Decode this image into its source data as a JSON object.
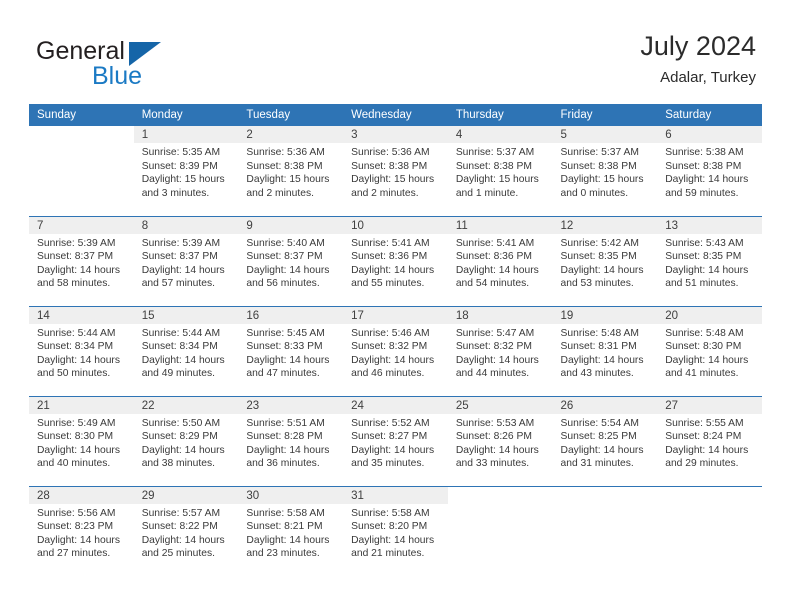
{
  "brand": {
    "word1": "General",
    "word2": "Blue",
    "flag_icon": "blue-flag-icon",
    "accent_color": "#1b7ac4"
  },
  "header": {
    "title": "July 2024",
    "subtitle": "Adalar, Turkey"
  },
  "theme": {
    "header_bg": "#2e74b5",
    "daynum_bg": "#efefef",
    "grid_line": "#2e74b5",
    "text": "#3a3a3a"
  },
  "calendar": {
    "weekday_headers": [
      "Sunday",
      "Monday",
      "Tuesday",
      "Wednesday",
      "Thursday",
      "Friday",
      "Saturday"
    ],
    "weeks": [
      [
        {
          "day": "",
          "lines": []
        },
        {
          "day": "1",
          "lines": [
            "Sunrise: 5:35 AM",
            "Sunset: 8:39 PM",
            "Daylight: 15 hours",
            "and 3 minutes."
          ]
        },
        {
          "day": "2",
          "lines": [
            "Sunrise: 5:36 AM",
            "Sunset: 8:38 PM",
            "Daylight: 15 hours",
            "and 2 minutes."
          ]
        },
        {
          "day": "3",
          "lines": [
            "Sunrise: 5:36 AM",
            "Sunset: 8:38 PM",
            "Daylight: 15 hours",
            "and 2 minutes."
          ]
        },
        {
          "day": "4",
          "lines": [
            "Sunrise: 5:37 AM",
            "Sunset: 8:38 PM",
            "Daylight: 15 hours",
            "and 1 minute."
          ]
        },
        {
          "day": "5",
          "lines": [
            "Sunrise: 5:37 AM",
            "Sunset: 8:38 PM",
            "Daylight: 15 hours",
            "and 0 minutes."
          ]
        },
        {
          "day": "6",
          "lines": [
            "Sunrise: 5:38 AM",
            "Sunset: 8:38 PM",
            "Daylight: 14 hours",
            "and 59 minutes."
          ]
        }
      ],
      [
        {
          "day": "7",
          "lines": [
            "Sunrise: 5:39 AM",
            "Sunset: 8:37 PM",
            "Daylight: 14 hours",
            "and 58 minutes."
          ]
        },
        {
          "day": "8",
          "lines": [
            "Sunrise: 5:39 AM",
            "Sunset: 8:37 PM",
            "Daylight: 14 hours",
            "and 57 minutes."
          ]
        },
        {
          "day": "9",
          "lines": [
            "Sunrise: 5:40 AM",
            "Sunset: 8:37 PM",
            "Daylight: 14 hours",
            "and 56 minutes."
          ]
        },
        {
          "day": "10",
          "lines": [
            "Sunrise: 5:41 AM",
            "Sunset: 8:36 PM",
            "Daylight: 14 hours",
            "and 55 minutes."
          ]
        },
        {
          "day": "11",
          "lines": [
            "Sunrise: 5:41 AM",
            "Sunset: 8:36 PM",
            "Daylight: 14 hours",
            "and 54 minutes."
          ]
        },
        {
          "day": "12",
          "lines": [
            "Sunrise: 5:42 AM",
            "Sunset: 8:35 PM",
            "Daylight: 14 hours",
            "and 53 minutes."
          ]
        },
        {
          "day": "13",
          "lines": [
            "Sunrise: 5:43 AM",
            "Sunset: 8:35 PM",
            "Daylight: 14 hours",
            "and 51 minutes."
          ]
        }
      ],
      [
        {
          "day": "14",
          "lines": [
            "Sunrise: 5:44 AM",
            "Sunset: 8:34 PM",
            "Daylight: 14 hours",
            "and 50 minutes."
          ]
        },
        {
          "day": "15",
          "lines": [
            "Sunrise: 5:44 AM",
            "Sunset: 8:34 PM",
            "Daylight: 14 hours",
            "and 49 minutes."
          ]
        },
        {
          "day": "16",
          "lines": [
            "Sunrise: 5:45 AM",
            "Sunset: 8:33 PM",
            "Daylight: 14 hours",
            "and 47 minutes."
          ]
        },
        {
          "day": "17",
          "lines": [
            "Sunrise: 5:46 AM",
            "Sunset: 8:32 PM",
            "Daylight: 14 hours",
            "and 46 minutes."
          ]
        },
        {
          "day": "18",
          "lines": [
            "Sunrise: 5:47 AM",
            "Sunset: 8:32 PM",
            "Daylight: 14 hours",
            "and 44 minutes."
          ]
        },
        {
          "day": "19",
          "lines": [
            "Sunrise: 5:48 AM",
            "Sunset: 8:31 PM",
            "Daylight: 14 hours",
            "and 43 minutes."
          ]
        },
        {
          "day": "20",
          "lines": [
            "Sunrise: 5:48 AM",
            "Sunset: 8:30 PM",
            "Daylight: 14 hours",
            "and 41 minutes."
          ]
        }
      ],
      [
        {
          "day": "21",
          "lines": [
            "Sunrise: 5:49 AM",
            "Sunset: 8:30 PM",
            "Daylight: 14 hours",
            "and 40 minutes."
          ]
        },
        {
          "day": "22",
          "lines": [
            "Sunrise: 5:50 AM",
            "Sunset: 8:29 PM",
            "Daylight: 14 hours",
            "and 38 minutes."
          ]
        },
        {
          "day": "23",
          "lines": [
            "Sunrise: 5:51 AM",
            "Sunset: 8:28 PM",
            "Daylight: 14 hours",
            "and 36 minutes."
          ]
        },
        {
          "day": "24",
          "lines": [
            "Sunrise: 5:52 AM",
            "Sunset: 8:27 PM",
            "Daylight: 14 hours",
            "and 35 minutes."
          ]
        },
        {
          "day": "25",
          "lines": [
            "Sunrise: 5:53 AM",
            "Sunset: 8:26 PM",
            "Daylight: 14 hours",
            "and 33 minutes."
          ]
        },
        {
          "day": "26",
          "lines": [
            "Sunrise: 5:54 AM",
            "Sunset: 8:25 PM",
            "Daylight: 14 hours",
            "and 31 minutes."
          ]
        },
        {
          "day": "27",
          "lines": [
            "Sunrise: 5:55 AM",
            "Sunset: 8:24 PM",
            "Daylight: 14 hours",
            "and 29 minutes."
          ]
        }
      ],
      [
        {
          "day": "28",
          "lines": [
            "Sunrise: 5:56 AM",
            "Sunset: 8:23 PM",
            "Daylight: 14 hours",
            "and 27 minutes."
          ]
        },
        {
          "day": "29",
          "lines": [
            "Sunrise: 5:57 AM",
            "Sunset: 8:22 PM",
            "Daylight: 14 hours",
            "and 25 minutes."
          ]
        },
        {
          "day": "30",
          "lines": [
            "Sunrise: 5:58 AM",
            "Sunset: 8:21 PM",
            "Daylight: 14 hours",
            "and 23 minutes."
          ]
        },
        {
          "day": "31",
          "lines": [
            "Sunrise: 5:58 AM",
            "Sunset: 8:20 PM",
            "Daylight: 14 hours",
            "and 21 minutes."
          ]
        },
        {
          "day": "",
          "lines": []
        },
        {
          "day": "",
          "lines": []
        },
        {
          "day": "",
          "lines": []
        }
      ]
    ]
  }
}
